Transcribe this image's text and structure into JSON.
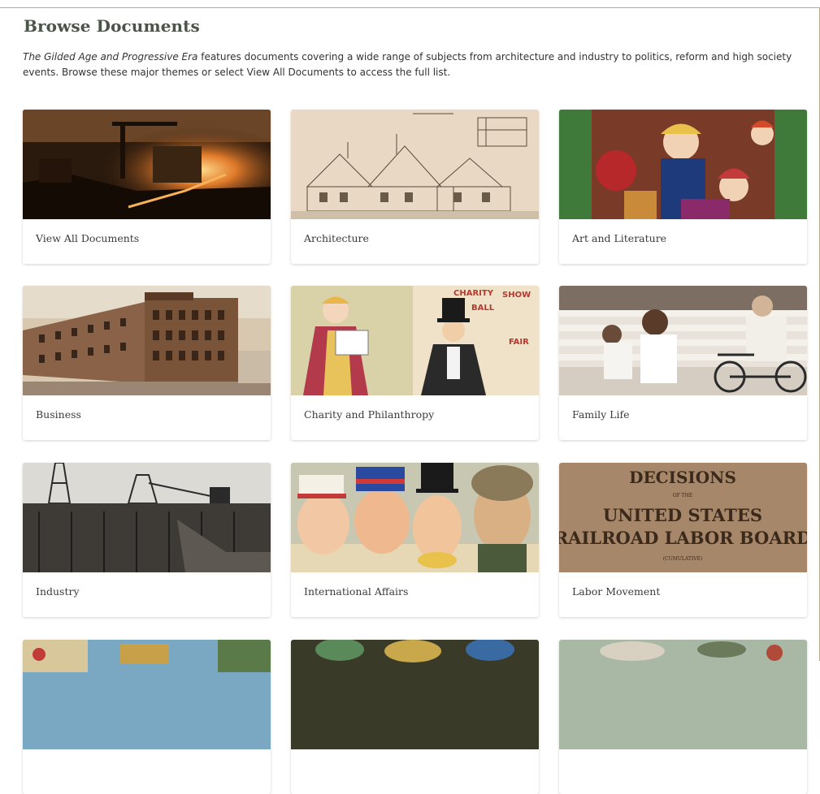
{
  "page": {
    "title": "Browse Documents",
    "intro_italic": "The Gilded Age and Progressive Era",
    "intro_rest": " features documents covering a wide range of subjects from architecture and industry to politics, reform and high society events. Browse these major themes or select View All Documents to access the full list."
  },
  "cards": [
    {
      "label": "View All Documents",
      "image": "steel-mill-furnace-photo"
    },
    {
      "label": "Architecture",
      "image": "tudor-house-sketch"
    },
    {
      "label": "Art and Literature",
      "image": "art-nouveau-illustration"
    },
    {
      "label": "Business",
      "image": "commercial-building-photo"
    },
    {
      "label": "Charity and Philanthropy",
      "image": "charity-ball-cartoon"
    },
    {
      "label": "Family Life",
      "image": "children-on-porch-photo"
    },
    {
      "label": "Industry",
      "image": "mining-trestle-photo"
    },
    {
      "label": "International Affairs",
      "image": "caricature-faces-cartoon"
    },
    {
      "label": "Labor Movement",
      "image": "railroad-labor-board-document"
    },
    {
      "label": "",
      "image": "colorful-postcard"
    },
    {
      "label": "",
      "image": "ornate-poster"
    },
    {
      "label": "",
      "image": "painted-illustration"
    }
  ],
  "labor_document": {
    "line1": "DECISIONS",
    "line2": "OF THE",
    "line3": "UNITED STATES",
    "line4": "RAILROAD LABOR BOARD",
    "line5": "(CUMULATIVE)"
  },
  "charity_sign": {
    "l1": "CHARITY",
    "l2": "BALL",
    "l3": "SHOW",
    "l4": "FAIR"
  },
  "colors": {
    "title": "#4b5448",
    "frame": "#b3ac87",
    "label": "#3b3b3b"
  }
}
